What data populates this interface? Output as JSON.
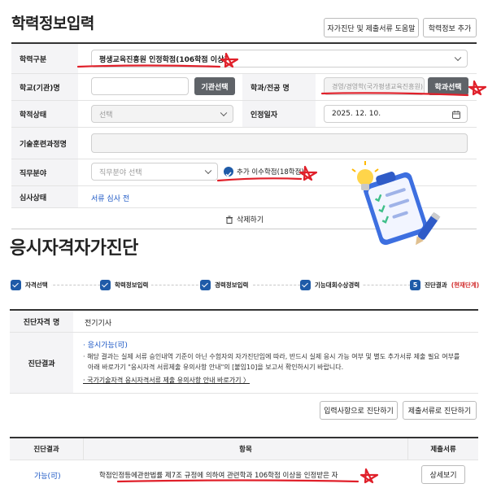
{
  "education": {
    "title": "학력정보입력",
    "help_button": "자가진단 및 제출서류 도움말",
    "add_button": "학력정보 추가",
    "rows": {
      "type_label": "학력구분",
      "type_value": "평생교육진흥원 인정학점(106학점 이상)",
      "school_label": "학교(기관)명",
      "school_value": "",
      "school_button": "기관선택",
      "major_label": "학과/전공 명",
      "major_placeholder": "경영/경영학(국가평생교육진흥원)...",
      "major_button": "학과선택",
      "status_label": "학적상태",
      "status_placeholder": "선택",
      "date_label": "인정일자",
      "date_value": "2025. 12. 10.",
      "training_label": "기술훈련과정명",
      "training_value": "",
      "job_label": "직무분야",
      "job_placeholder": "직무분야 선택",
      "extra_credit_label": "추가 이수학점(18학점)",
      "review_label": "심사상태",
      "review_value": "서류 심사 전",
      "delete_button": "삭제하기"
    }
  },
  "diagnosis": {
    "title": "응시자격자가진단",
    "steps": [
      {
        "label": "자격선택",
        "done": true
      },
      {
        "label": "학력정보입력",
        "done": true
      },
      {
        "label": "경력정보입력",
        "done": true
      },
      {
        "label": "기능대회수상경력",
        "done": true
      },
      {
        "label": "진단결과",
        "number": "5",
        "current": "(현재단계)"
      }
    ],
    "qual_label": "진단자격 명",
    "qual_value": "전기기사",
    "result_label": "진단결과",
    "result_link": "· 응시가능(可)",
    "note_line1": "· 해당 결과는 실제 서류 승인내역 기준이 아닌 수험자의 자가진단임에 따라, 반드시 실제 응시 가능 여부 및 별도 추가서류 제출 필요 여부를",
    "note_line2": "아래 바로가기 \"응시자격 서류제출 유의사항 안내\"의 [붙임10]을 보고서 확인하시기 바랍니다.",
    "note_link": "· 국가기술자격 응시자격서류 제출 유의사항 안내 바로가기 〉",
    "btn_input": "입력사항으로 진단하기",
    "btn_docs": "제출서류로 진단하기",
    "table": {
      "headers": [
        "진단결과",
        "항목",
        "제출서류"
      ],
      "row": {
        "result": "가능(可)",
        "item": "학점인정등에관한법률 제7조 규정에 의하여 관련학과 106학점 이상을 인정받은 자",
        "docs_button": "상세보기"
      }
    }
  },
  "colors": {
    "accent": "#1f5ba8",
    "link": "#1a56c4",
    "annotation": "#e0202a",
    "current_step": "#d12b2b"
  },
  "icons": [
    "calendar-icon",
    "trash-icon",
    "check-icon",
    "chevron-down-icon",
    "star-annotation",
    "clipboard-illustration"
  ]
}
